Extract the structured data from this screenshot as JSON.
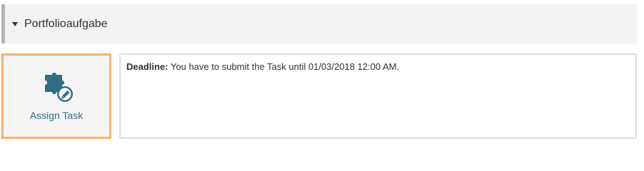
{
  "section": {
    "title": "Portfolioaufgabe",
    "toggle_icon": "caret-down-icon"
  },
  "assign": {
    "label": "Assign Task",
    "icon": "puzzle-pencil-icon",
    "icon_color": "#2f6e86",
    "border_color": "#f7b26a"
  },
  "info": {
    "deadline_label": "Deadline:",
    "deadline_text": "You have to submit the Task until 01/03/2018 12:00 AM."
  }
}
